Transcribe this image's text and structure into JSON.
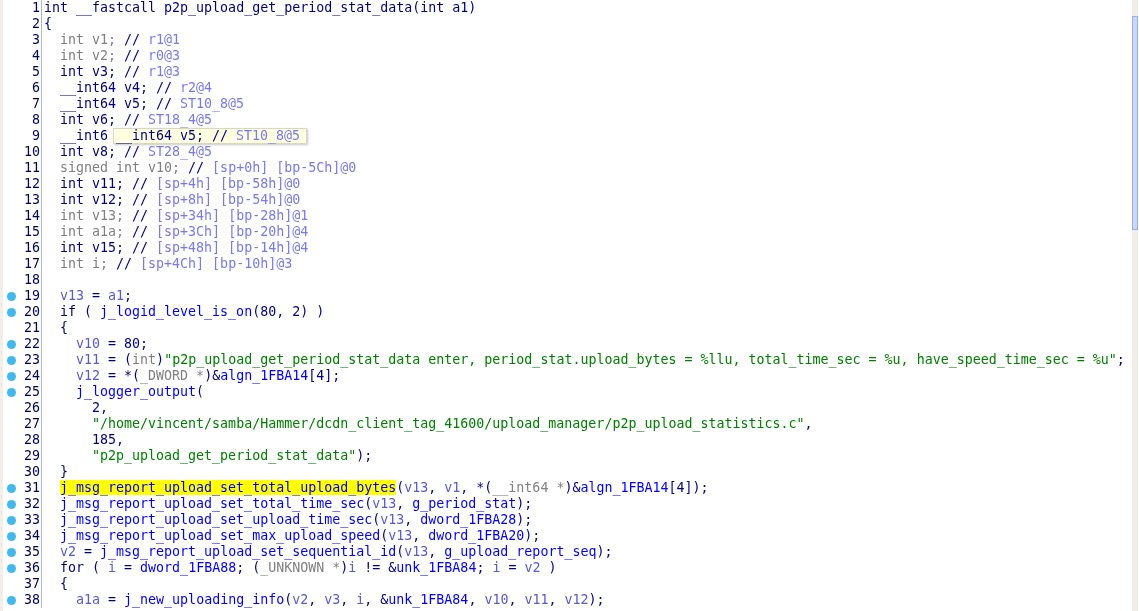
{
  "lines": [
    {
      "number": "1",
      "dot": false,
      "kind": "top",
      "tokens": [
        {
          "t": "int __fastcall p2p_upload_get_period_stat_data(int a1)",
          "kind": "keyword"
        }
      ]
    },
    {
      "number": "2",
      "dot": false,
      "kind": "top",
      "tokens": [
        {
          "t": "{",
          "kind": "keyword"
        }
      ]
    },
    {
      "number": "3",
      "dot": false,
      "kind": "block",
      "tokens": [
        {
          "t": "int v1; ",
          "kind": "unused"
        },
        {
          "t": "//",
          "kind": "keyword"
        },
        {
          "t": " r1@1",
          "kind": "comment"
        }
      ]
    },
    {
      "number": "4",
      "dot": false,
      "kind": "block",
      "tokens": [
        {
          "t": "int v2; ",
          "kind": "unused"
        },
        {
          "t": "//",
          "kind": "keyword"
        },
        {
          "t": " r0@3",
          "kind": "comment"
        }
      ]
    },
    {
      "number": "5",
      "dot": false,
      "kind": "block",
      "tokens": [
        {
          "t": "int v3; //",
          "kind": "keyword"
        },
        {
          "t": " r1@3",
          "kind": "comment"
        }
      ]
    },
    {
      "number": "6",
      "dot": false,
      "kind": "block",
      "tokens": [
        {
          "t": "__int64 v4; //",
          "kind": "keyword"
        },
        {
          "t": " r2@4",
          "kind": "comment"
        }
      ]
    },
    {
      "number": "7",
      "dot": false,
      "kind": "block",
      "tokens": [
        {
          "t": "__int64 v5; //",
          "kind": "keyword"
        },
        {
          "t": " ST10_8@5",
          "kind": "comment"
        }
      ]
    },
    {
      "number": "8",
      "dot": false,
      "kind": "block",
      "tokens": [
        {
          "t": "int v6; //",
          "kind": "keyword"
        },
        {
          "t": " ST18_4@5",
          "kind": "comment"
        }
      ]
    },
    {
      "number": "9",
      "dot": false,
      "kind": "block",
      "tokens": [
        {
          "t": "__int6",
          "kind": "keyword"
        }
      ]
    },
    {
      "number": "10",
      "dot": false,
      "kind": "block",
      "tokens": [
        {
          "t": "int v8; //",
          "kind": "keyword"
        },
        {
          "t": " ST28_4@5",
          "kind": "comment"
        }
      ]
    },
    {
      "number": "11",
      "dot": false,
      "kind": "block",
      "tokens": [
        {
          "t": "signed int v10; ",
          "kind": "unused"
        },
        {
          "t": "//",
          "kind": "keyword"
        },
        {
          "t": " [sp+0h] [bp-5Ch]@0",
          "kind": "comment"
        }
      ]
    },
    {
      "number": "12",
      "dot": false,
      "kind": "block",
      "tokens": [
        {
          "t": "int v11; //",
          "kind": "keyword"
        },
        {
          "t": " [sp+4h] [bp-58h]@0",
          "kind": "comment"
        }
      ]
    },
    {
      "number": "13",
      "dot": false,
      "kind": "block",
      "tokens": [
        {
          "t": "int v12; //",
          "kind": "keyword"
        },
        {
          "t": " [sp+8h] [bp-54h]@0",
          "kind": "comment"
        }
      ]
    },
    {
      "number": "14",
      "dot": false,
      "kind": "block",
      "tokens": [
        {
          "t": "int v13; ",
          "kind": "unused"
        },
        {
          "t": "//",
          "kind": "keyword"
        },
        {
          "t": " [sp+34h] [bp-28h]@1",
          "kind": "comment"
        }
      ]
    },
    {
      "number": "15",
      "dot": false,
      "kind": "block",
      "tokens": [
        {
          "t": "int a1a; ",
          "kind": "unused"
        },
        {
          "t": "//",
          "kind": "keyword"
        },
        {
          "t": " [sp+3Ch] [bp-20h]@4",
          "kind": "comment"
        }
      ]
    },
    {
      "number": "16",
      "dot": false,
      "kind": "block",
      "tokens": [
        {
          "t": "int v15; //",
          "kind": "keyword"
        },
        {
          "t": " [sp+48h] [bp-14h]@4",
          "kind": "comment"
        }
      ]
    },
    {
      "number": "17",
      "dot": false,
      "kind": "block",
      "tokens": [
        {
          "t": "int i; ",
          "kind": "unused"
        },
        {
          "t": "//",
          "kind": "keyword"
        },
        {
          "t": " [sp+4Ch] [bp-10h]@3",
          "kind": "comment"
        }
      ]
    },
    {
      "number": "18",
      "dot": false,
      "kind": "top"
    },
    {
      "number": "19",
      "dot": true,
      "kind": "block",
      "tokens": [
        {
          "t": "v13",
          "kind": "var"
        },
        {
          "t": " = ",
          "kind": "keyword"
        },
        {
          "t": "a1",
          "kind": "var"
        },
        {
          "t": ";",
          "kind": "keyword"
        }
      ]
    },
    {
      "number": "20",
      "dot": true,
      "kind": "block",
      "tokens": [
        {
          "t": "if ( ",
          "kind": "keyword"
        },
        {
          "t": "j_logid_level_is_on",
          "kind": "name"
        },
        {
          "t": "(80, 2) )",
          "kind": "keyword"
        }
      ]
    },
    {
      "number": "21",
      "dot": false,
      "kind": "block",
      "tokens": [
        {
          "t": "{",
          "kind": "keyword"
        }
      ]
    },
    {
      "number": "22",
      "dot": true,
      "kind": "inner",
      "tokens": [
        {
          "t": "v10",
          "kind": "var"
        },
        {
          "t": " = 80;",
          "kind": "keyword"
        }
      ]
    },
    {
      "number": "23",
      "dot": true,
      "kind": "inner",
      "tokens": [
        {
          "t": "v11",
          "kind": "var"
        },
        {
          "t": " = (",
          "kind": "keyword"
        },
        {
          "t": "int",
          "kind": "unused"
        },
        {
          "t": ")",
          "kind": "keyword"
        },
        {
          "t": "\"p2p_upload_get_period_stat_data enter, period_stat.upload_bytes = %llu, total_time_sec = %u, have_speed_time_sec = %u\"",
          "kind": "string"
        },
        {
          "t": ";",
          "kind": "keyword"
        }
      ]
    },
    {
      "number": "24",
      "dot": true,
      "kind": "inner",
      "tokens": [
        {
          "t": "v12",
          "kind": "var"
        },
        {
          "t": " = *(",
          "kind": "keyword"
        },
        {
          "t": "_DWORD *",
          "kind": "unused"
        },
        {
          "t": ")&",
          "kind": "keyword"
        },
        {
          "t": "algn_1FBA14",
          "kind": "name"
        },
        {
          "t": "[4];",
          "kind": "keyword"
        }
      ]
    },
    {
      "number": "25",
      "dot": true,
      "kind": "inner",
      "tokens": [
        {
          "t": "j_logger_output",
          "kind": "name"
        },
        {
          "t": "(",
          "kind": "keyword"
        }
      ]
    },
    {
      "number": "26",
      "dot": false,
      "kind": "arg",
      "tokens": [
        {
          "t": "2,",
          "kind": "keyword"
        }
      ]
    },
    {
      "number": "27",
      "dot": false,
      "kind": "arg",
      "tokens": [
        {
          "t": "\"/home/vincent/samba/Hammer/dcdn_client_tag_41600/upload_manager/p2p_upload_statistics.c\"",
          "kind": "string"
        },
        {
          "t": ",",
          "kind": "keyword"
        }
      ]
    },
    {
      "number": "28",
      "dot": false,
      "kind": "arg",
      "tokens": [
        {
          "t": "185,",
          "kind": "keyword"
        }
      ]
    },
    {
      "number": "29",
      "dot": false,
      "kind": "arg",
      "tokens": [
        {
          "t": "\"p2p_upload_get_period_stat_data\"",
          "kind": "string"
        },
        {
          "t": ");",
          "kind": "keyword"
        }
      ]
    },
    {
      "number": "30",
      "dot": false,
      "kind": "block",
      "tokens": [
        {
          "t": "}",
          "kind": "keyword"
        }
      ]
    },
    {
      "number": "31",
      "dot": true,
      "kind": "block",
      "tokens": [
        {
          "t": "j_msg_report_upload_set_total_upload_bytes",
          "kind": "name",
          "highlighted": true
        },
        {
          "t": "(",
          "kind": "keyword"
        },
        {
          "t": "v13",
          "kind": "var"
        },
        {
          "t": ", ",
          "kind": "keyword"
        },
        {
          "t": "v1",
          "kind": "var"
        },
        {
          "t": ", *(",
          "kind": "keyword"
        },
        {
          "t": "__int64 *",
          "kind": "unused"
        },
        {
          "t": ")&",
          "kind": "keyword"
        },
        {
          "t": "algn_1FBA14",
          "kind": "name"
        },
        {
          "t": "[4]);",
          "kind": "keyword"
        }
      ]
    },
    {
      "number": "32",
      "dot": true,
      "kind": "block",
      "tokens": [
        {
          "t": "j_msg_report_upload_set_total_time_sec",
          "kind": "name"
        },
        {
          "t": "(",
          "kind": "keyword"
        },
        {
          "t": "v13",
          "kind": "var"
        },
        {
          "t": ", ",
          "kind": "keyword"
        },
        {
          "t": "g_period_stat",
          "kind": "name"
        },
        {
          "t": ");",
          "kind": "keyword"
        }
      ]
    },
    {
      "number": "33",
      "dot": true,
      "kind": "block",
      "tokens": [
        {
          "t": "j_msg_report_upload_set_upload_time_sec",
          "kind": "name"
        },
        {
          "t": "(",
          "kind": "keyword"
        },
        {
          "t": "v13",
          "kind": "var"
        },
        {
          "t": ", ",
          "kind": "keyword"
        },
        {
          "t": "dword_1FBA28",
          "kind": "name"
        },
        {
          "t": ");",
          "kind": "keyword"
        }
      ]
    },
    {
      "number": "34",
      "dot": true,
      "kind": "block",
      "tokens": [
        {
          "t": "j_msg_report_upload_set_max_upload_speed",
          "kind": "name"
        },
        {
          "t": "(",
          "kind": "keyword"
        },
        {
          "t": "v13",
          "kind": "var"
        },
        {
          "t": ", ",
          "kind": "keyword"
        },
        {
          "t": "dword_1FBA20",
          "kind": "name"
        },
        {
          "t": ");",
          "kind": "keyword"
        }
      ]
    },
    {
      "number": "35",
      "dot": true,
      "kind": "block",
      "tokens": [
        {
          "t": "v2",
          "kind": "var"
        },
        {
          "t": " = ",
          "kind": "keyword"
        },
        {
          "t": "j_msg_report_upload_set_sequential_id",
          "kind": "name"
        },
        {
          "t": "(",
          "kind": "keyword"
        },
        {
          "t": "v13",
          "kind": "var"
        },
        {
          "t": ", ",
          "kind": "keyword"
        },
        {
          "t": "g_upload_report_seq",
          "kind": "name"
        },
        {
          "t": ");",
          "kind": "keyword"
        }
      ]
    },
    {
      "number": "36",
      "dot": true,
      "kind": "block",
      "tokens": [
        {
          "t": "for ( ",
          "kind": "keyword"
        },
        {
          "t": "i",
          "kind": "var"
        },
        {
          "t": " = ",
          "kind": "keyword"
        },
        {
          "t": "dword_1FBA88",
          "kind": "name"
        },
        {
          "t": "; (",
          "kind": "keyword"
        },
        {
          "t": "_UNKNOWN *",
          "kind": "unused"
        },
        {
          "t": ")",
          "kind": "keyword"
        },
        {
          "t": "i",
          "kind": "var"
        },
        {
          "t": " != &",
          "kind": "keyword"
        },
        {
          "t": "unk_1FBA84",
          "kind": "name"
        },
        {
          "t": "; ",
          "kind": "keyword"
        },
        {
          "t": "i",
          "kind": "var"
        },
        {
          "t": " = ",
          "kind": "keyword"
        },
        {
          "t": "v2",
          "kind": "var"
        },
        {
          "t": " )",
          "kind": "keyword"
        }
      ]
    },
    {
      "number": "37",
      "dot": false,
      "kind": "block",
      "tokens": [
        {
          "t": "{",
          "kind": "keyword"
        }
      ]
    },
    {
      "number": "38",
      "dot": true,
      "kind": "inner",
      "tokens": [
        {
          "t": "a1a",
          "kind": "var"
        },
        {
          "t": " = ",
          "kind": "keyword"
        },
        {
          "t": "j_new_uploading_info",
          "kind": "name"
        },
        {
          "t": "(",
          "kind": "keyword"
        },
        {
          "t": "v2",
          "kind": "var"
        },
        {
          "t": ", ",
          "kind": "keyword"
        },
        {
          "t": "v3",
          "kind": "var"
        },
        {
          "t": ", ",
          "kind": "keyword"
        },
        {
          "t": "i",
          "kind": "var"
        },
        {
          "t": ", &",
          "kind": "keyword"
        },
        {
          "t": "unk_1FBA84",
          "kind": "name"
        },
        {
          "t": ", ",
          "kind": "keyword"
        },
        {
          "t": "v10",
          "kind": "var"
        },
        {
          "t": ", ",
          "kind": "keyword"
        },
        {
          "t": "v11",
          "kind": "var"
        },
        {
          "t": ", ",
          "kind": "keyword"
        },
        {
          "t": "v12",
          "kind": "var"
        },
        {
          "t": ");",
          "kind": "keyword"
        }
      ]
    }
  ],
  "tooltip": {
    "tokens": [
      {
        "t": "__int64 v5; //",
        "kind": "keyword"
      },
      {
        "t": " ST10_8@5",
        "kind": "comment"
      }
    ]
  }
}
